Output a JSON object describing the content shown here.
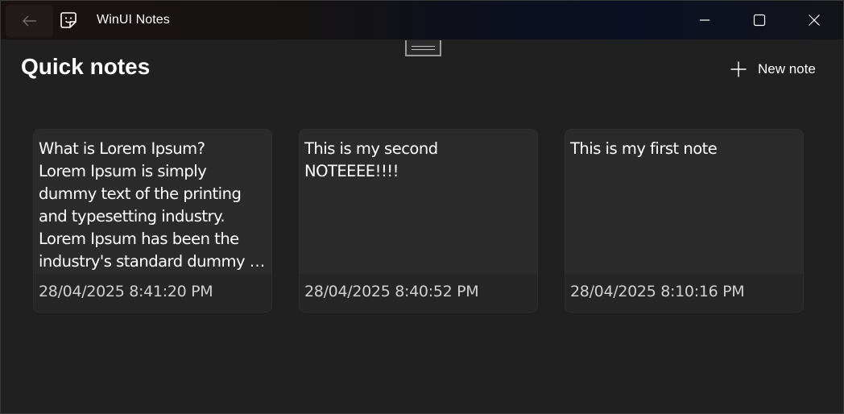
{
  "window": {
    "title": "WinUI Notes",
    "back_icon": "back-arrow-icon",
    "app_icon": "sticky-note-icon",
    "caption": {
      "minimize_icon": "minimize-icon",
      "maximize_icon": "maximize-icon",
      "close_icon": "close-icon"
    }
  },
  "header": {
    "title": "Quick notes",
    "new_note_label": "New note",
    "new_note_icon": "plus-icon"
  },
  "notes": [
    {
      "text": "What is Lorem Ipsum?\nLorem Ipsum is simply dummy text of the printing and typesetting industry. Lorem Ipsum has been the industry's standard dummy text ever…",
      "timestamp": "28/04/2025 8:41:20 PM"
    },
    {
      "text": "This is my second NOTEEEE!!!!",
      "timestamp": "28/04/2025 8:40:52 PM"
    },
    {
      "text": "This is my first note",
      "timestamp": "28/04/2025 8:10:16 PM"
    }
  ],
  "colors": {
    "background": "#202020",
    "card": "#2b2b2b",
    "card_footer": "#262626",
    "text": "#ffffff",
    "timestamp": "#d0d0d0"
  }
}
